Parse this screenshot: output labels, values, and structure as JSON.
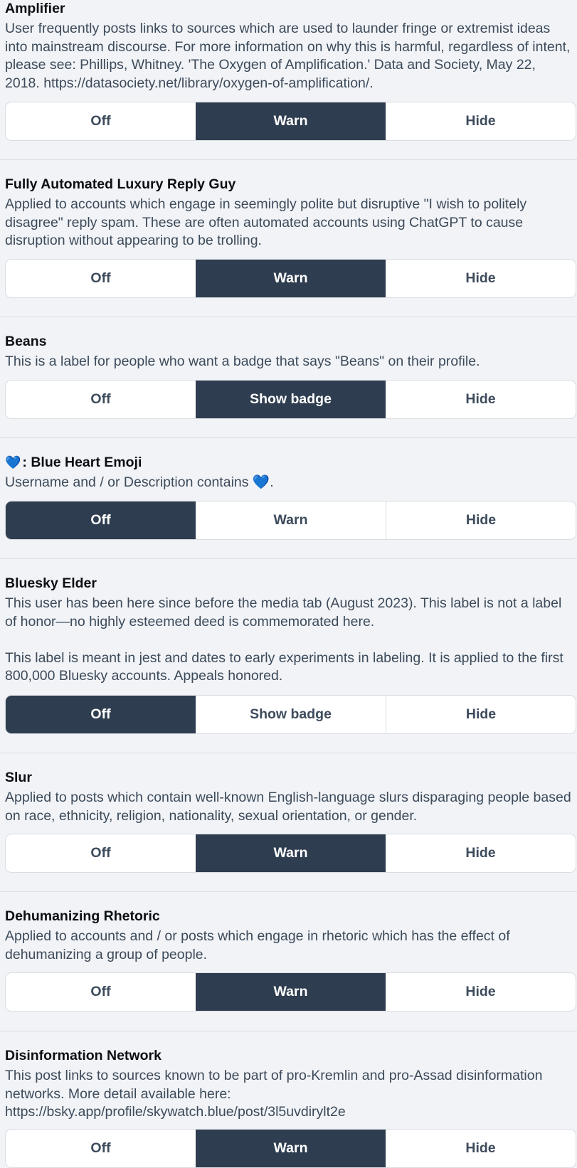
{
  "labels": [
    {
      "title": "Amplifier",
      "description": [
        "User frequently posts links to sources which are used to launder fringe or extremist ideas into mainstream discourse. For more information on why this is harmful, regardless of intent, please see: Phillips, Whitney. 'The Oxygen of Amplification.' Data and Society, May 22, 2018. https://datasociety.net/library/oxygen-of-amplification/."
      ],
      "options": [
        "Off",
        "Warn",
        "Hide"
      ],
      "selected": "Warn"
    },
    {
      "title": "Fully Automated Luxury Reply Guy",
      "description": [
        "Applied to accounts which engage in seemingly polite but disruptive \"I wish to politely disagree\" reply spam. These are often automated accounts using ChatGPT to cause disruption without appearing to be trolling."
      ],
      "options": [
        "Off",
        "Warn",
        "Hide"
      ],
      "selected": "Warn"
    },
    {
      "title": "Beans",
      "description": [
        "This is a label for people who want a badge that says \"Beans\" on their profile."
      ],
      "options": [
        "Off",
        "Show badge",
        "Hide"
      ],
      "selected": "Show badge"
    },
    {
      "title_emoji": "💙",
      "title": ": Blue Heart Emoji",
      "description": [
        "Username and / or Description contains 💙."
      ],
      "options": [
        "Off",
        "Warn",
        "Hide"
      ],
      "selected": "Off"
    },
    {
      "title": "Bluesky Elder",
      "description": [
        "This user has been here since before the media tab (August 2023). This label is not a label of honor—no highly esteemed deed is commemorated here.",
        "This label is meant in jest and dates to early experiments in labeling. It is applied to the first 800,000 Bluesky accounts. Appeals honored."
      ],
      "options": [
        "Off",
        "Show badge",
        "Hide"
      ],
      "selected": "Off"
    },
    {
      "title": "Slur",
      "description": [
        "Applied to posts which contain well-known English-language slurs disparaging people based on race, ethnicity, religion, nationality, sexual orientation, or gender."
      ],
      "options": [
        "Off",
        "Warn",
        "Hide"
      ],
      "selected": "Warn"
    },
    {
      "title": "Dehumanizing Rhetoric",
      "description": [
        "Applied to accounts and / or posts which engage in rhetoric which has the effect of dehumanizing a group of people."
      ],
      "options": [
        "Off",
        "Warn",
        "Hide"
      ],
      "selected": "Warn"
    },
    {
      "title": "Disinformation Network",
      "description": [
        "This post links to sources known to be part of pro-Kremlin and pro-Assad disinformation networks. More detail available here: https://bsky.app/profile/skywatch.blue/post/3l5uvdirylt2e"
      ],
      "options": [
        "Off",
        "Warn",
        "Hide"
      ],
      "selected": "Warn"
    }
  ],
  "colors": {
    "background": "#f1f3f6",
    "active_segment": "#2e3d4f",
    "segment_text": "#3d4b5c",
    "description_text": "#3c4a5a",
    "divider": "#dcdfe4"
  }
}
